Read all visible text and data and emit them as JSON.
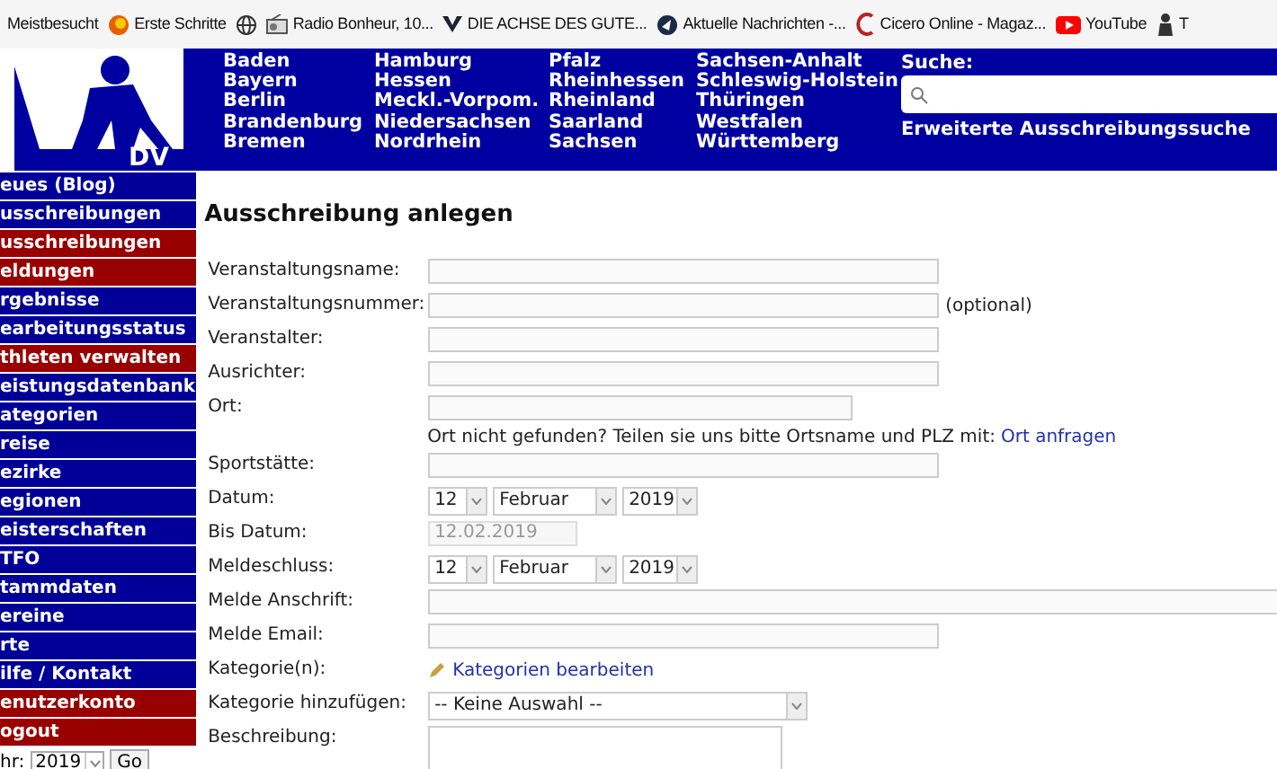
{
  "bookmarks": [
    {
      "kind": "plain",
      "label": "Meistbesucht"
    },
    {
      "kind": "fox",
      "label": "Erste Schritte"
    },
    {
      "kind": "globe"
    },
    {
      "kind": "radio",
      "label": "Radio Bonheur, 10..."
    },
    {
      "kind": "v",
      "label": "DIE ACHSE DES GUTE..."
    },
    {
      "kind": "news",
      "label": "Aktuelle Nachrichten -..."
    },
    {
      "kind": "c",
      "label": "Cicero Online - Magaz..."
    },
    {
      "kind": "yt",
      "label": "YouTube"
    },
    {
      "kind": "figure",
      "label": "T"
    }
  ],
  "logo": {
    "text": "DV"
  },
  "regions": [
    [
      "Baden",
      "Bayern",
      "Berlin",
      "Brandenburg",
      "Bremen"
    ],
    [
      "Hamburg",
      "Hessen",
      "Meckl.-Vorpom.",
      "Niedersachsen",
      "Nordrhein"
    ],
    [
      "Pfalz",
      "Rheinhessen",
      "Rheinland",
      "Saarland",
      "Sachsen"
    ],
    [
      "Sachsen-Anhalt",
      "Schleswig-Holstein",
      "Thüringen",
      "Westfalen",
      "Württemberg"
    ]
  ],
  "search": {
    "label": "Suche:",
    "link": "Erweiterte Ausschreibungssuche"
  },
  "sidebar": {
    "items": [
      {
        "label": "eues (Blog)",
        "color": "#000099"
      },
      {
        "label": "usschreibungen",
        "color": "#000099"
      },
      {
        "label": "usschreibungen",
        "color": "#990000"
      },
      {
        "label": "eldungen",
        "color": "#990000"
      },
      {
        "label": "rgebnisse",
        "color": "#000099"
      },
      {
        "label": "earbeitungsstatus",
        "color": "#000099"
      },
      {
        "label": "thleten verwalten",
        "color": "#990000"
      },
      {
        "label": "eistungsdatenbank",
        "color": "#000099"
      },
      {
        "label": "ategorien",
        "color": "#000099"
      },
      {
        "label": "reise",
        "color": "#000099"
      },
      {
        "label": "ezirke",
        "color": "#000099"
      },
      {
        "label": "egionen",
        "color": "#000099"
      },
      {
        "label": "eisterschaften",
        "color": "#000099"
      },
      {
        "label": "TFO",
        "color": "#000099"
      },
      {
        "label": "tammdaten",
        "color": "#000099"
      },
      {
        "label": "ereine",
        "color": "#000099"
      },
      {
        "label": "rte",
        "color": "#000099"
      },
      {
        "label": "ilfe / Kontakt",
        "color": "#000099"
      },
      {
        "label": "enutzerkonto",
        "color": "#990000"
      },
      {
        "label": "ogout",
        "color": "#990000"
      }
    ],
    "year_label": "hr:",
    "year": "2019",
    "go": "Go"
  },
  "title": "Ausschreibung anlegen",
  "form": [
    {
      "kind": "text",
      "label": "Veranstaltungsname:"
    },
    {
      "kind": "text",
      "label": "Veranstaltungsnummer:",
      "note": "(optional)"
    },
    {
      "kind": "text",
      "label": "Veranstalter:"
    },
    {
      "kind": "text",
      "label": "Ausrichter:"
    },
    {
      "kind": "place",
      "label": "Ort:",
      "hint": "Ort nicht gefunden? Teilen sie uns bitte Ortsname und PLZ mit:",
      "link": "Ort anfragen"
    },
    {
      "kind": "text",
      "label": "Sportstätte:"
    },
    {
      "kind": "date",
      "label": "Datum:",
      "day": "12",
      "month": "Februar",
      "year": "2019"
    },
    {
      "kind": "readonly",
      "label": "Bis Datum:",
      "value": "12.02.2019"
    },
    {
      "kind": "date",
      "label": "Meldeschluss:",
      "day": "12",
      "month": "Februar",
      "year": "2019"
    },
    {
      "kind": "wide",
      "label": "Melde Anschrift:"
    },
    {
      "kind": "text",
      "label": "Melde Email:"
    },
    {
      "kind": "edit",
      "label": "Kategorie(n):",
      "link": "Kategorien bearbeiten"
    },
    {
      "kind": "select",
      "label": "Kategorie hinzufügen:",
      "value": "-- Keine Auswahl --"
    },
    {
      "kind": "textarea",
      "label": "Beschreibung:"
    }
  ]
}
